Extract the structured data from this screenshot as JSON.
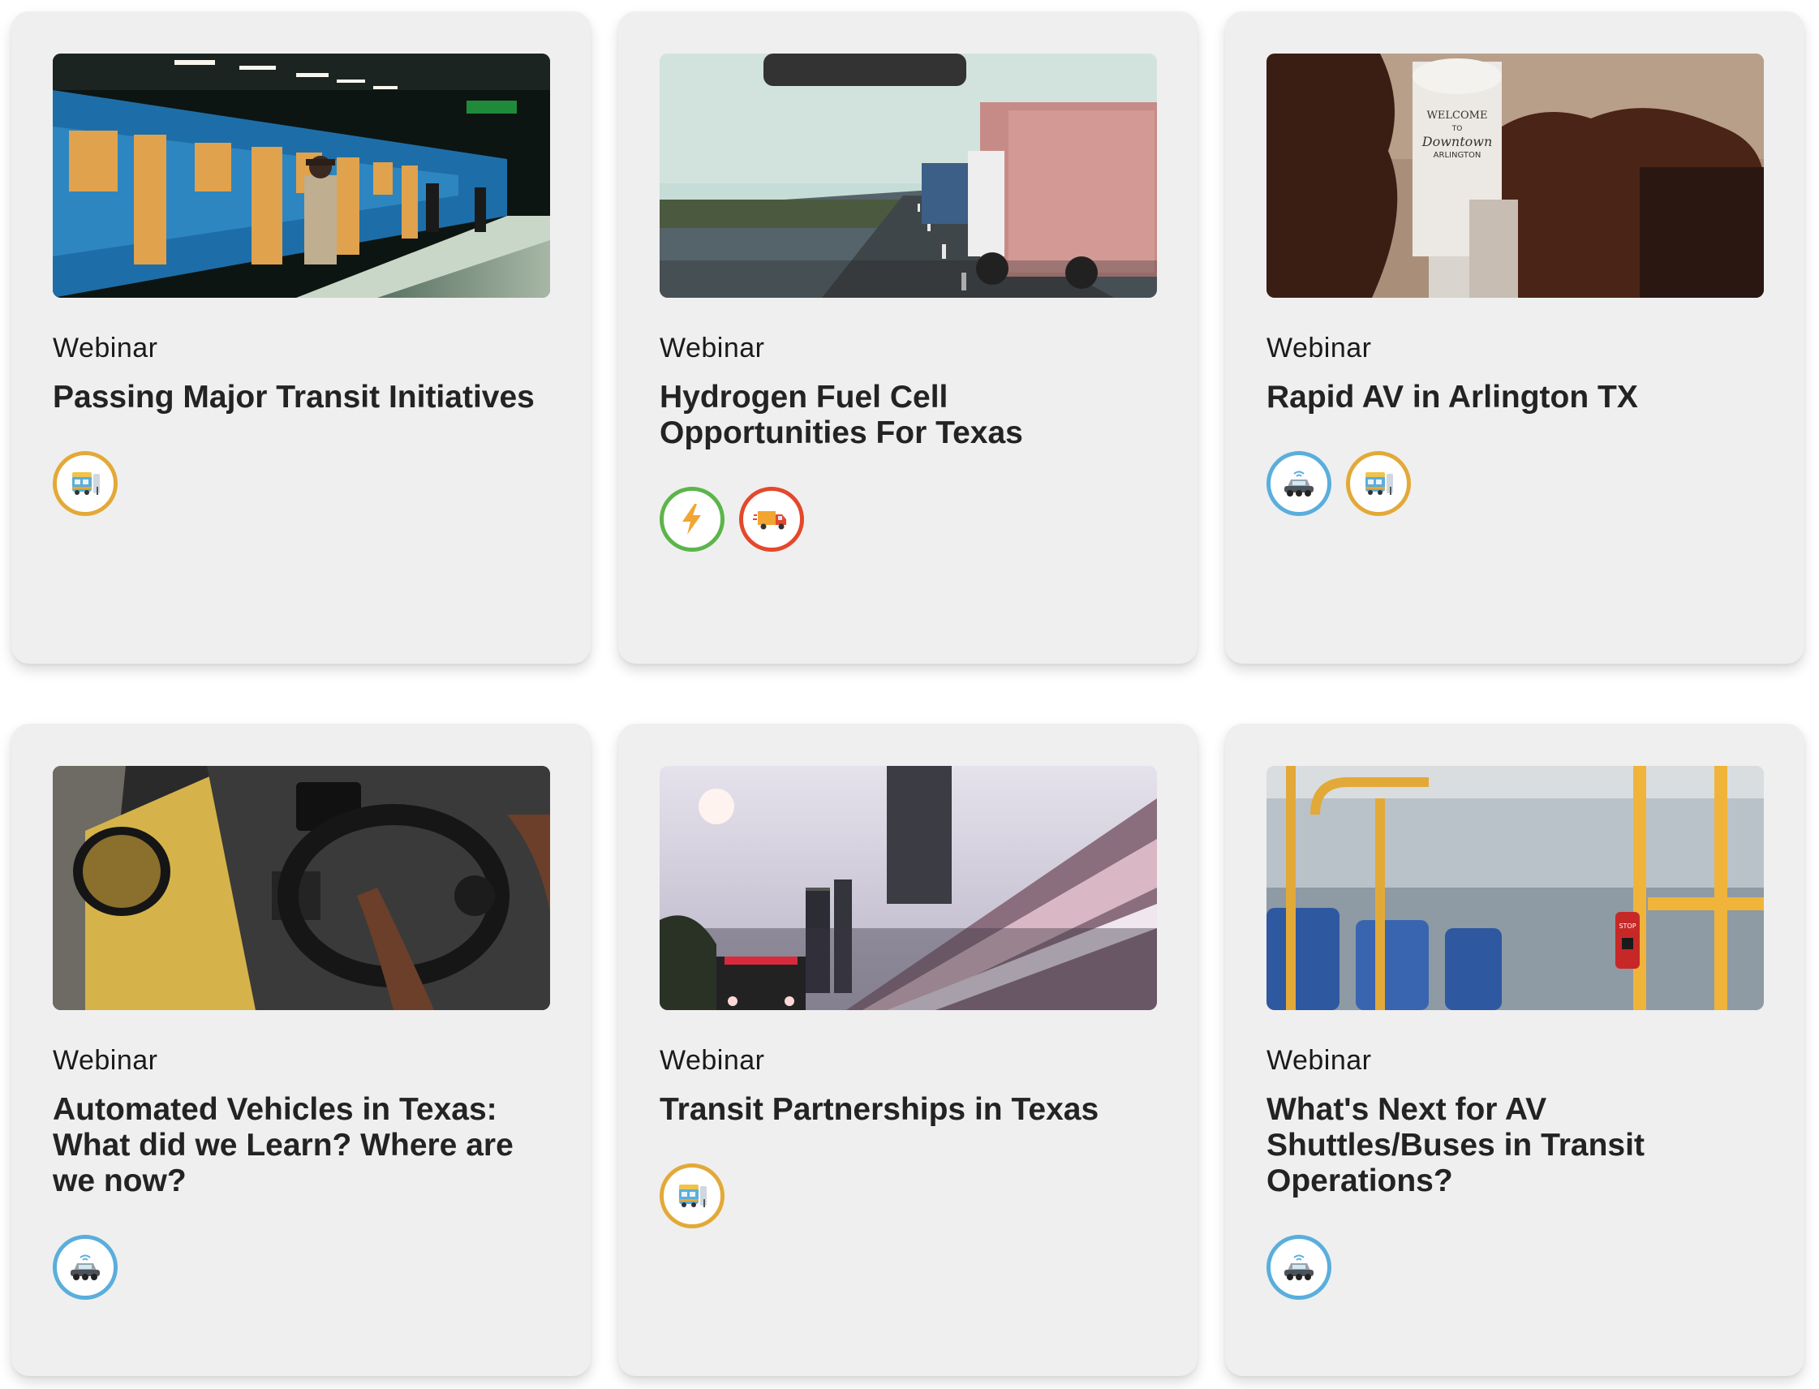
{
  "cards": [
    {
      "category": "Webinar",
      "title": "Passing Major Transit Initiatives",
      "image": "subway-train-platform",
      "tags": [
        "transit-icon"
      ]
    },
    {
      "category": "Webinar",
      "title": "Hydrogen Fuel Cell Opportunities For Texas",
      "image": "highway-trucks",
      "tags": [
        "lightning-icon",
        "truck-icon"
      ]
    },
    {
      "category": "Webinar",
      "title": "Rapid AV in Arlington TX",
      "image": "arlington-water-tower",
      "tags": [
        "autonomous-vehicle-icon",
        "transit-icon"
      ]
    },
    {
      "category": "Webinar",
      "title": "Automated Vehicles in Texas: What did we Learn? Where are we now?",
      "image": "car-steering-wheel",
      "tags": [
        "autonomous-vehicle-icon"
      ]
    },
    {
      "category": "Webinar",
      "title": "Transit Partnerships in Texas",
      "image": "city-bus-light-trails",
      "tags": [
        "transit-icon"
      ]
    },
    {
      "category": "Webinar",
      "title": "What's Next for AV Shuttles/Buses in Transit Operations?",
      "image": "bus-interior-stop-button",
      "tags": [
        "autonomous-vehicle-icon"
      ]
    }
  ],
  "image_text": {
    "water_tower_line1": "WELCOME",
    "water_tower_line2": "TO",
    "water_tower_line3": "Downtown",
    "water_tower_line4": "ARLINGTON",
    "stop_button": "STOP"
  },
  "colors": {
    "card_bg": "#efefef",
    "transit": "#e3a938",
    "av": "#5aaedc",
    "energy": "#5cb54a",
    "freight": "#e4482c"
  }
}
